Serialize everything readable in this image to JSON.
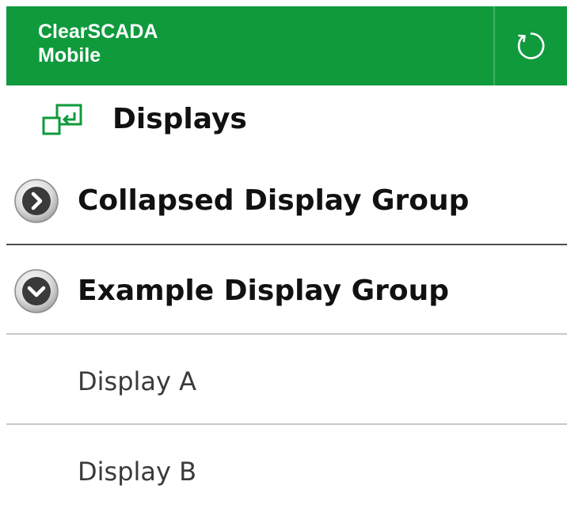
{
  "header": {
    "title_line1": "ClearSCADA",
    "title_line2": "Mobile",
    "refresh_icon": "refresh-icon",
    "background_color": "#0f9a3c"
  },
  "section": {
    "title": "Displays",
    "icon": "displays-icon",
    "icon_color": "#0f9a3c"
  },
  "groups": [
    {
      "label": "Collapsed Display Group",
      "state": "collapsed",
      "icon": "chevron-right-icon"
    },
    {
      "label": "Example Display Group",
      "state": "expanded",
      "icon": "chevron-down-icon",
      "items": [
        {
          "label": "Display A"
        },
        {
          "label": "Display B"
        }
      ]
    }
  ]
}
